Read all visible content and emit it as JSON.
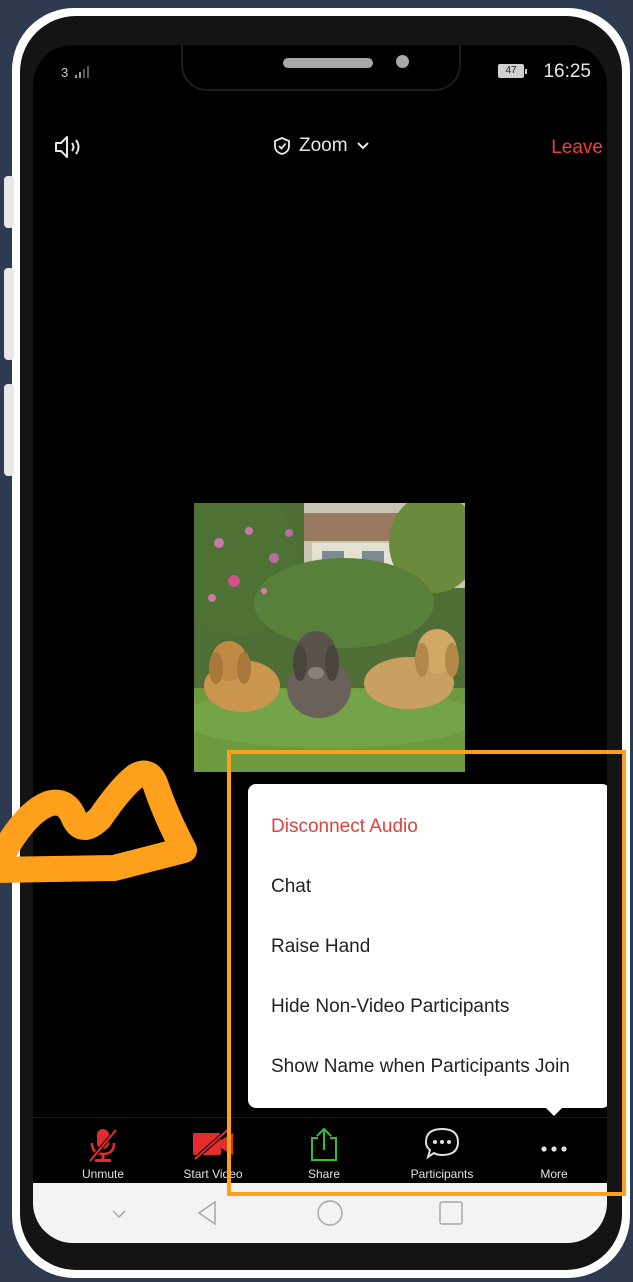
{
  "status_bar": {
    "signal": "3",
    "battery": "47",
    "time": "16:25"
  },
  "meeting_bar": {
    "title": "Zoom",
    "leave_label": "Leave"
  },
  "more_menu": {
    "items": [
      {
        "label": "Disconnect Audio"
      },
      {
        "label": "Chat"
      },
      {
        "label": "Raise Hand"
      },
      {
        "label": "Hide Non-Video Participants"
      },
      {
        "label": "Show Name when Participants Join"
      }
    ]
  },
  "toolbar": {
    "unmute_label": "Unmute",
    "start_video_label": "Start Video",
    "share_label": "Share",
    "participants_label": "Participants",
    "more_label": "More"
  },
  "colors": {
    "leave": "#e8423a",
    "danger_item": "#e0423d",
    "muted_icon": "#e32c2c",
    "share_icon": "#2fbf34",
    "highlight": "#ffa01d",
    "background": "#2d3a4f"
  },
  "icons": [
    "speaker-icon",
    "shield-icon",
    "chevron-down-icon",
    "microphone-muted-icon",
    "video-off-icon",
    "share-upload-icon",
    "chat-bubble-icon",
    "more-dots-icon",
    "nav-down-icon",
    "nav-back-icon",
    "nav-home-icon",
    "nav-recents-icon"
  ]
}
